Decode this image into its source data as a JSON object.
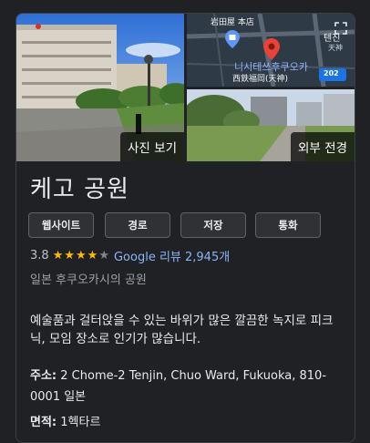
{
  "photos": {
    "main_label": "사진 보기",
    "street_label": "외부 전경",
    "map_labels": {
      "store": "岩田屋 本店",
      "tenjin_top": "텐진",
      "tenjin_side": "天神",
      "nishitetsu_kr": "니시테쓰후쿠오카",
      "nishitetsu_jp": "西鉄福岡(天神)",
      "route": "202"
    }
  },
  "place": {
    "title": "케고 공원",
    "subtitle": "일본 후쿠오카시의 공원"
  },
  "actions": {
    "website": "웹사이트",
    "directions": "경로",
    "save": "저장",
    "call": "통화"
  },
  "rating": {
    "value": "3.8",
    "stars_filled": 4,
    "stars_total": 5,
    "reviews_text": "Google 리뷰 2,945개"
  },
  "description": "예술품과 걸터앉을 수 있는 바위가 많은 깔끔한 녹지로 피크닉, 모임 장소로 인기가 많습니다.",
  "address": {
    "label": "주소:",
    "value": "2 Chome-2 Tenjin, Chuo Ward, Fukuoka, 810-0001 일본"
  },
  "area": {
    "label": "면적:",
    "value": "1헥타르"
  },
  "colors": {
    "background": "#202124",
    "link": "#8ab4f8",
    "star": "#fbbc04",
    "map_pin": "#ea4335"
  }
}
